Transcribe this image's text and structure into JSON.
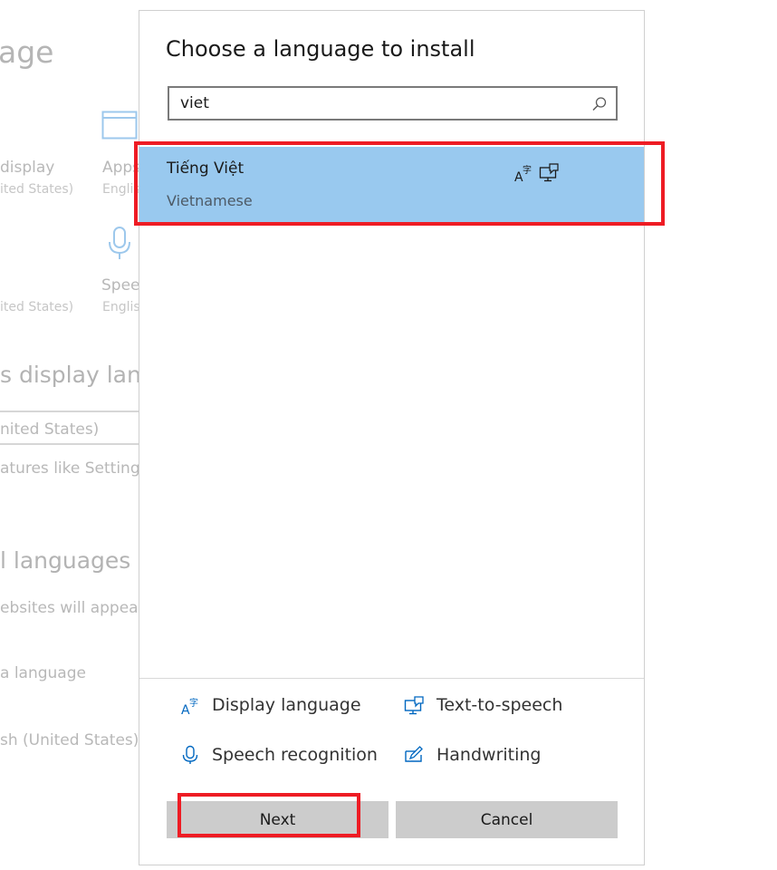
{
  "background": {
    "title_fragment": "age",
    "tile_display_label": "display",
    "tile_display_sub": "ited States)",
    "tile_apps_label": "Apps",
    "tile_apps_sub": "Englis",
    "tile_speech_sub": "ited States)",
    "tile_speech_label": "Speec",
    "tile_speech_sub2": "Englis",
    "section1_heading": "s display langu",
    "section1_dropdown": "nited States)",
    "section1_desc": "atures like Settings a",
    "section2_heading": "l languages",
    "section2_desc": "ebsites will appear in",
    "add_language": "a language",
    "installed_language": "sh (United States)"
  },
  "dialog": {
    "title": "Choose a language to install",
    "search": {
      "value": "viet",
      "placeholder": ""
    },
    "result": {
      "native_name": "Tiếng Việt",
      "english_name": "Vietnamese"
    },
    "legend": {
      "display_language": "Display language",
      "text_to_speech": "Text-to-speech",
      "speech_recognition": "Speech recognition",
      "handwriting": "Handwriting"
    },
    "buttons": {
      "next": "Next",
      "cancel": "Cancel"
    }
  },
  "colors": {
    "selection": "#99c9ef",
    "icon_blue": "#0067c0",
    "annotation_red": "#ee1c24",
    "button_gray": "#cccccc"
  }
}
